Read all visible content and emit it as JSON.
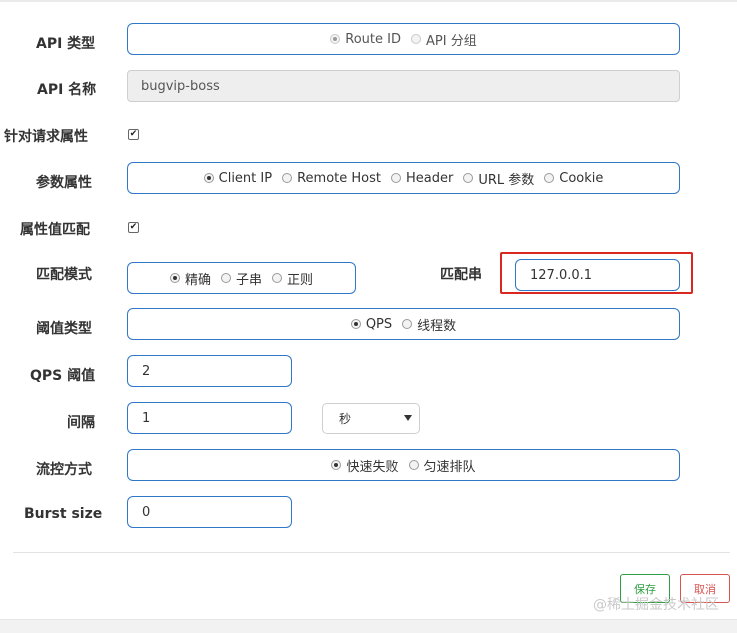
{
  "form": {
    "api_type": {
      "label": "API 类型",
      "options": [
        "Route ID",
        "API 分组"
      ]
    },
    "api_name": {
      "label": "API 名称",
      "value": "bugvip-boss"
    },
    "request_attr": {
      "label": "针对请求属性",
      "checked_mark": "✔"
    },
    "param_attr": {
      "label": "参数属性",
      "options": [
        "Client IP",
        "Remote Host",
        "Header",
        "URL 参数",
        "Cookie"
      ]
    },
    "attr_match": {
      "label": "属性值匹配",
      "checked_mark": "✔"
    },
    "match_mode": {
      "label": "匹配模式",
      "options": [
        "精确",
        "子串",
        "正则"
      ]
    },
    "match_string": {
      "label": "匹配串",
      "value": "127.0.0.1"
    },
    "threshold_type": {
      "label": "阈值类型",
      "options": [
        "QPS",
        "线程数"
      ]
    },
    "qps_threshold": {
      "label": "QPS 阈值",
      "value": "2"
    },
    "interval": {
      "label": "间隔",
      "value": "1",
      "unit_selected": "秒"
    },
    "flow_control": {
      "label": "流控方式",
      "options": [
        "快速失败",
        "匀速排队"
      ]
    },
    "burst_size": {
      "label": "Burst size",
      "value": "0"
    }
  },
  "footer": {
    "save_label": "保存",
    "cancel_label": "取消",
    "watermark": "@稀土掘金技术社区"
  },
  "colors": {
    "input_border": "#2f77c7",
    "highlight": "#d9281f",
    "save": "#2f9e44",
    "cancel": "#d9534f"
  }
}
